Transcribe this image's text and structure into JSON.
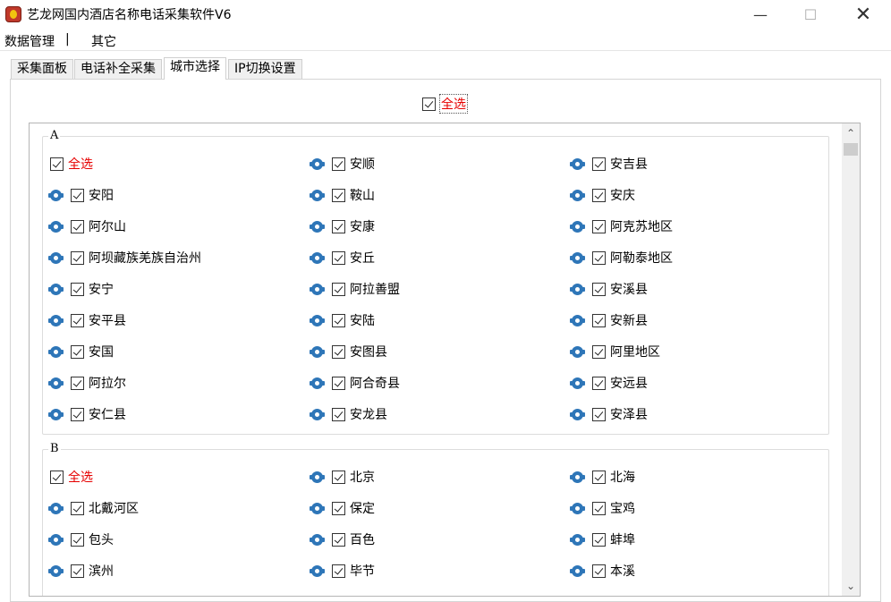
{
  "window": {
    "title": "艺龙网国内酒店名称电话采集软件V6",
    "min_glyph": "—",
    "max_glyph": "☐",
    "close_glyph": "✕"
  },
  "menu": {
    "data_manage": "数据管理",
    "separator": "|",
    "other": "其它"
  },
  "tabs": [
    "采集面板",
    "电话补全采集",
    "城市选择",
    "IP切换设置"
  ],
  "active_tab": "城市选择",
  "select_all_label": "全选",
  "scroll": {
    "up": "⌃",
    "down": "⌄"
  },
  "groups": [
    {
      "letter": "A",
      "select_all": "全选",
      "cities": [
        "安顺",
        "安吉县",
        "安阳",
        "鞍山",
        "安庆",
        "阿尔山",
        "安康",
        "阿克苏地区",
        "阿坝藏族羌族自治州",
        "安丘",
        "阿勒泰地区",
        "安宁",
        "阿拉善盟",
        "安溪县",
        "安平县",
        "安陆",
        "安新县",
        "安国",
        "安图县",
        "阿里地区",
        "阿拉尔",
        "阿合奇县",
        "安远县",
        "安仁县",
        "安龙县",
        "安泽县"
      ]
    },
    {
      "letter": "B",
      "select_all": "全选",
      "cities": [
        "北京",
        "北海",
        "北戴河区",
        "保定",
        "宝鸡",
        "包头",
        "百色",
        "蚌埠",
        "滨州",
        "毕节",
        "本溪"
      ]
    }
  ]
}
